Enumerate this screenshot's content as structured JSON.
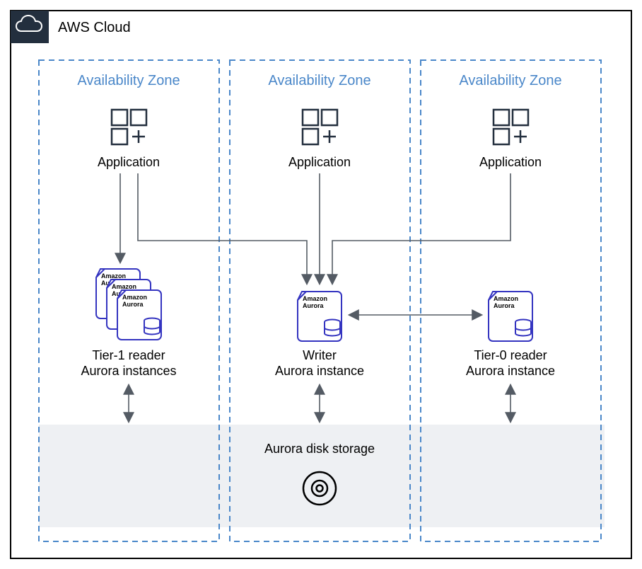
{
  "cloud": {
    "title": "AWS Cloud"
  },
  "zones": [
    {
      "title": "Availability Zone",
      "app_label": "Application",
      "db_label_line1": "Tier-1 reader",
      "db_label_line2": "Aurora instances",
      "aurora_small_label": "Amazon Au",
      "aurora_label_line1": "Amazon",
      "aurora_label_line2": "Aurora"
    },
    {
      "title": "Availability Zone",
      "app_label": "Application",
      "db_label_line1": "Writer",
      "db_label_line2": "Aurora instance",
      "aurora_label_line1": "Amazon",
      "aurora_label_line2": "Aurora"
    },
    {
      "title": "Availability Zone",
      "app_label": "Application",
      "db_label_line1": "Tier-0 reader",
      "db_label_line2": "Aurora instance",
      "aurora_label_line1": "Amazon",
      "aurora_label_line2": "Aurora"
    }
  ],
  "storage": {
    "label": "Aurora disk storage"
  },
  "colors": {
    "az_border": "#4a87c9",
    "aurora": "#3434c0",
    "arrow": "#545b64",
    "storage_fill": "#eef0f3",
    "cloud_badge": "#232f3e"
  }
}
